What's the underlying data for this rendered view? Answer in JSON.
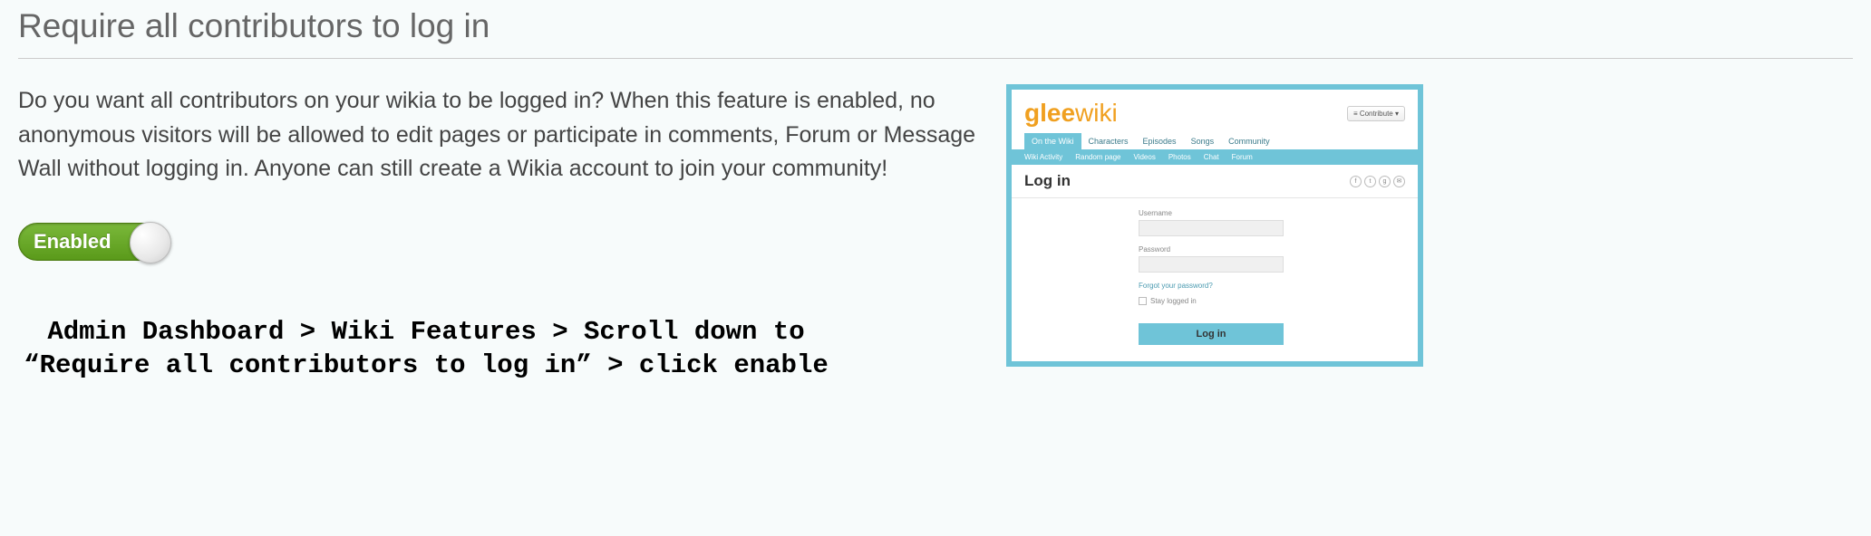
{
  "feature": {
    "title": "Require all contributors to log in",
    "description": "Do you want all contributors on your wikia to be logged in? When this feature is enabled, no anonymous visitors will be allowed to edit pages or participate in comments, Forum or Message Wall without logging in. Anyone can still create a Wikia account to join your community!",
    "toggle_label": "Enabled"
  },
  "instructions": {
    "line1": "Admin Dashboard > Wiki Features > Scroll down to",
    "line2": "“Require all contributors to log in” > click enable"
  },
  "preview": {
    "logo_prefix": "glee",
    "logo_suffix": "wiki",
    "contribute": "Contribute",
    "tabs": [
      "On the Wiki",
      "Characters",
      "Episodes",
      "Songs",
      "Community"
    ],
    "subtabs": [
      "Wiki Activity",
      "Random page",
      "Videos",
      "Photos",
      "Chat",
      "Forum"
    ],
    "login_heading": "Log in",
    "username_label": "Username",
    "password_label": "Password",
    "forgot": "Forgot your password?",
    "stay": "Stay logged in",
    "login_button": "Log in"
  }
}
